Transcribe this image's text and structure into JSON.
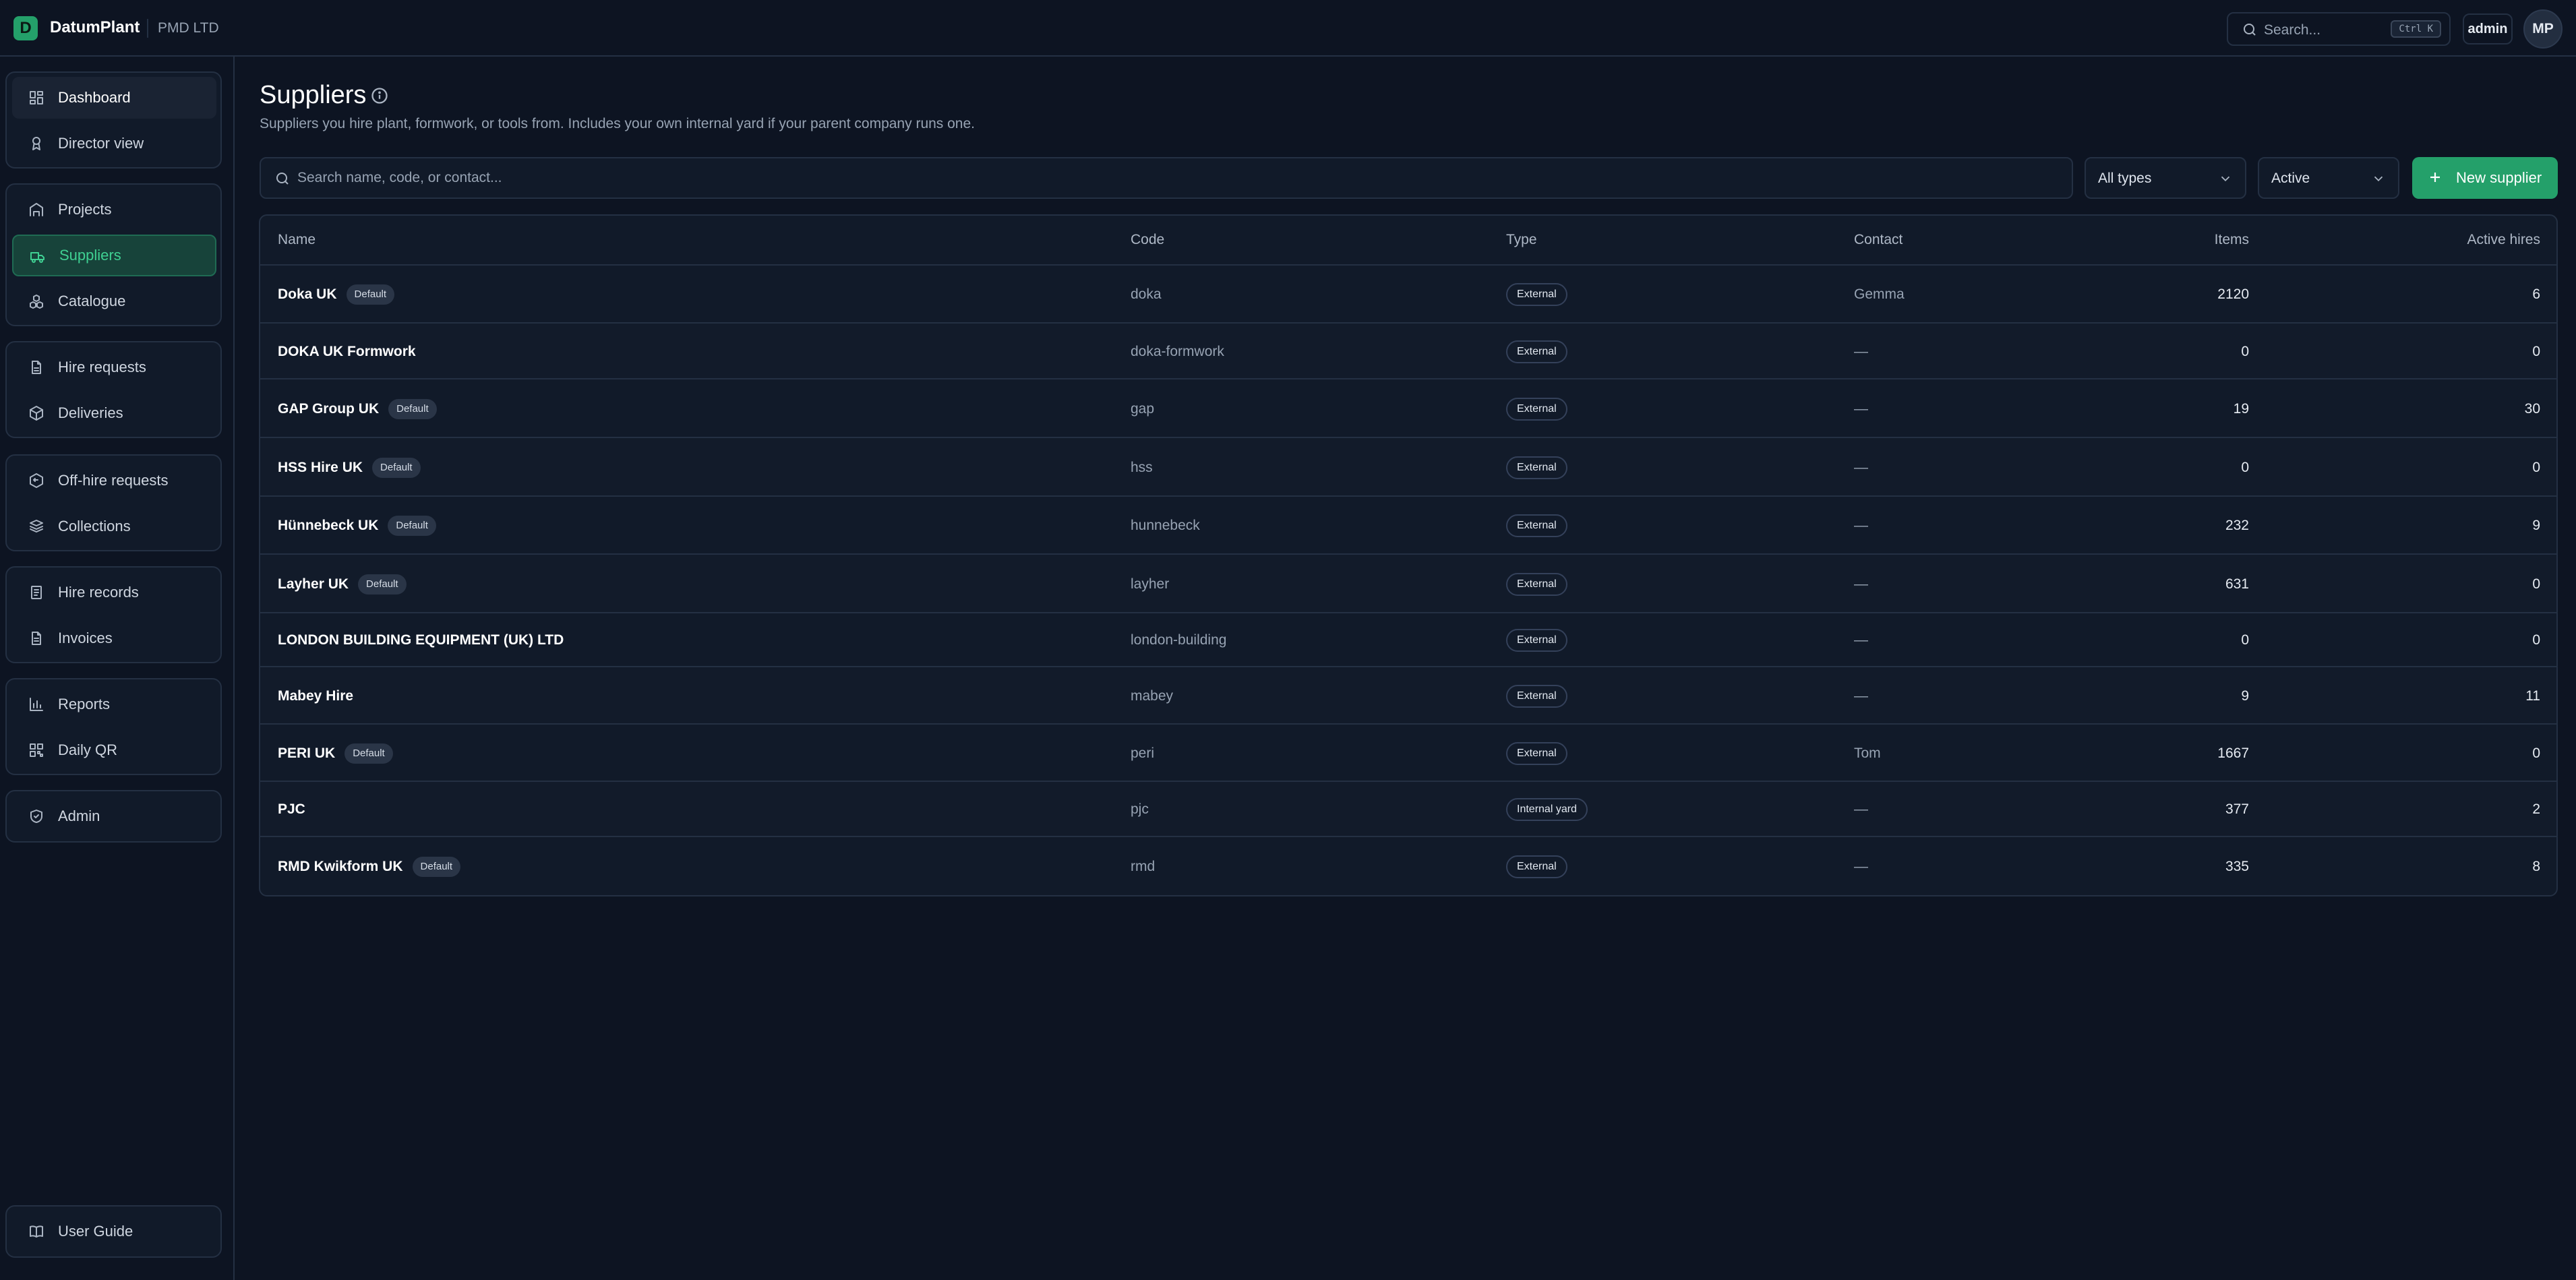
{
  "header": {
    "logo_letter": "D",
    "brand": "DatumPlant",
    "org": "PMD LTD",
    "search_placeholder": "Search...",
    "search_shortcut": "Ctrl K",
    "role": "admin",
    "avatar_initials": "MP"
  },
  "sidebar": {
    "items": [
      {
        "label": "Dashboard",
        "icon": "dashboard-icon"
      },
      {
        "label": "Director view",
        "icon": "award-icon"
      },
      {
        "label": "Projects",
        "icon": "projects-icon"
      },
      {
        "label": "Suppliers",
        "icon": "truck-icon"
      },
      {
        "label": "Catalogue",
        "icon": "boxes-icon"
      },
      {
        "label": "Hire requests",
        "icon": "document-icon"
      },
      {
        "label": "Deliveries",
        "icon": "package-icon"
      },
      {
        "label": "Off-hire requests",
        "icon": "package-return-icon"
      },
      {
        "label": "Collections",
        "icon": "package-stack-icon"
      },
      {
        "label": "Hire records",
        "icon": "records-icon"
      },
      {
        "label": "Invoices",
        "icon": "invoice-icon"
      },
      {
        "label": "Reports",
        "icon": "bar-chart-icon"
      },
      {
        "label": "Daily QR",
        "icon": "qr-icon"
      },
      {
        "label": "Admin",
        "icon": "shield-icon"
      }
    ],
    "footer_item": {
      "label": "User Guide",
      "icon": "book-icon"
    },
    "active": "Suppliers"
  },
  "page": {
    "title": "Suppliers",
    "subtitle": "Suppliers you hire plant, formwork, or tools from. Includes your own internal yard if your parent company runs one."
  },
  "toolbar": {
    "search_placeholder": "Search name, code, or contact...",
    "type_filter": "All types",
    "status_filter": "Active",
    "new_button": "New supplier"
  },
  "table": {
    "columns": [
      "Name",
      "Code",
      "Type",
      "Contact",
      "Items",
      "Active hires"
    ],
    "rows": [
      {
        "name": "Doka UK",
        "badge": "Default",
        "code": "doka",
        "type": "External",
        "contact": "Gemma",
        "items": "2120",
        "active_hires": "6"
      },
      {
        "name": "DOKA UK Formwork",
        "badge": "",
        "code": "doka-formwork",
        "type": "External",
        "contact": "—",
        "items": "0",
        "active_hires": "0"
      },
      {
        "name": "GAP Group UK",
        "badge": "Default",
        "code": "gap",
        "type": "External",
        "contact": "—",
        "items": "19",
        "active_hires": "30"
      },
      {
        "name": "HSS Hire UK",
        "badge": "Default",
        "code": "hss",
        "type": "External",
        "contact": "—",
        "items": "0",
        "active_hires": "0"
      },
      {
        "name": "Hünnebeck UK",
        "badge": "Default",
        "code": "hunnebeck",
        "type": "External",
        "contact": "—",
        "items": "232",
        "active_hires": "9"
      },
      {
        "name": "Layher UK",
        "badge": "Default",
        "code": "layher",
        "type": "External",
        "contact": "—",
        "items": "631",
        "active_hires": "0"
      },
      {
        "name": "LONDON BUILDING EQUIPMENT (UK) LTD",
        "badge": "",
        "code": "london-building",
        "type": "External",
        "contact": "—",
        "items": "0",
        "active_hires": "0"
      },
      {
        "name": "Mabey Hire",
        "badge": "",
        "code": "mabey",
        "type": "External",
        "contact": "—",
        "items": "9",
        "active_hires": "11"
      },
      {
        "name": "PERI UK",
        "badge": "Default",
        "code": "peri",
        "type": "External",
        "contact": "Tom",
        "items": "1667",
        "active_hires": "0"
      },
      {
        "name": "PJC",
        "badge": "",
        "code": "pjc",
        "type": "Internal yard",
        "contact": "—",
        "items": "377",
        "active_hires": "2"
      },
      {
        "name": "RMD Kwikform UK",
        "badge": "Default",
        "code": "rmd",
        "type": "External",
        "contact": "—",
        "items": "335",
        "active_hires": "8"
      }
    ]
  }
}
